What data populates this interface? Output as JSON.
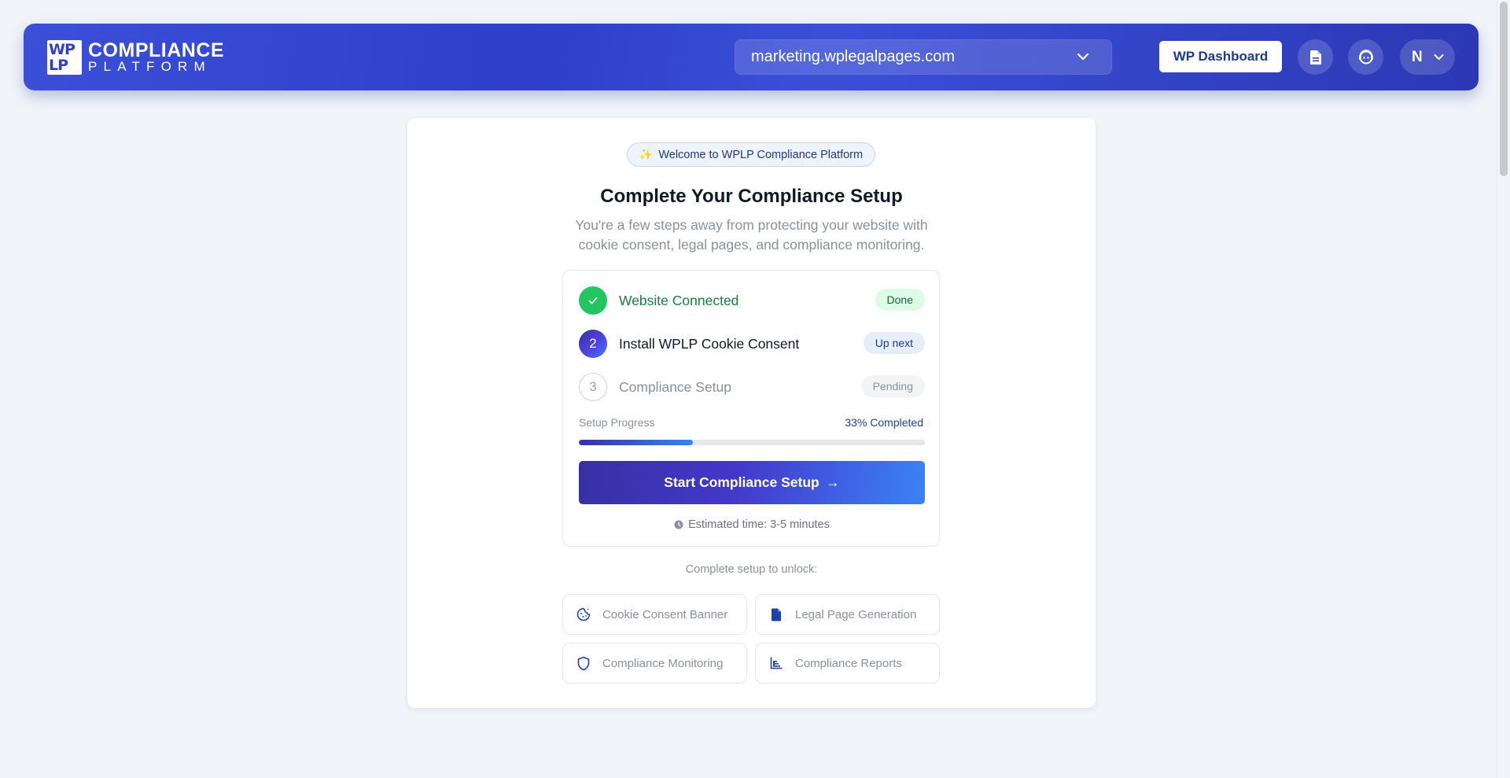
{
  "header": {
    "logo_mark_top": "WP",
    "logo_mark_bottom": "LP",
    "logo_line1": "COMPLIANCE",
    "logo_line2": "PLATFORM",
    "site_selector_value": "marketing.wplegalpages.com",
    "wp_dashboard_label": "WP Dashboard",
    "user_initial": "N"
  },
  "card": {
    "welcome_badge": "Welcome to WPLP Compliance Platform",
    "title": "Complete Your Compliance Setup",
    "subtitle": "You're a few steps away from protecting your website with cookie consent, legal pages, and compliance monitoring."
  },
  "steps": [
    {
      "number": "1",
      "label": "Website Connected",
      "status": "Done"
    },
    {
      "number": "2",
      "label": "Install WPLP Cookie Consent",
      "status": "Up next"
    },
    {
      "number": "3",
      "label": "Compliance Setup",
      "status": "Pending"
    }
  ],
  "progress": {
    "label": "Setup Progress",
    "value_text": "33% Completed",
    "percent": 33
  },
  "start_button_label": "Start Compliance Setup",
  "estimate_text": "Estimated time: 3-5 minutes",
  "unlock": {
    "title": "Complete setup to unlock:",
    "features": [
      {
        "label": "Cookie Consent Banner",
        "icon": "cookie-icon"
      },
      {
        "label": "Legal Page Generation",
        "icon": "document-icon"
      },
      {
        "label": "Compliance Monitoring",
        "icon": "shield-icon"
      },
      {
        "label": "Compliance Reports",
        "icon": "bar-chart-icon"
      }
    ]
  },
  "colors": {
    "header_gradient_start": "#3b4fd9",
    "header_gradient_end": "#2c38b5",
    "done_green": "#22c55e",
    "accent_blue": "#1e3a8a",
    "progress_fill_start": "#3730a3",
    "progress_fill_end": "#3b82f6"
  }
}
